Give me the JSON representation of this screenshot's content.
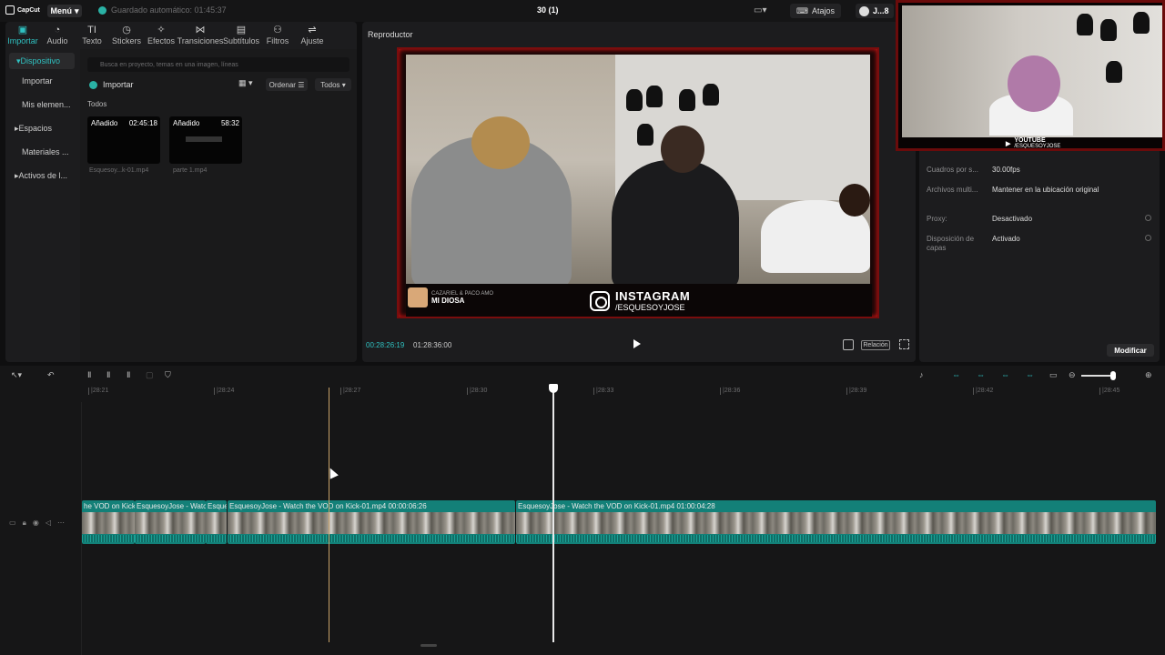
{
  "app": {
    "logo_text": "CapCut",
    "menu_label": "Menú",
    "autosave_text": "Guardado automático: 01:45:37",
    "project_title": "30 (1)",
    "shortcuts_label": "Atajos",
    "user_label": "J...8"
  },
  "tabs": [
    {
      "label": "Importar",
      "icon": "import-icon"
    },
    {
      "label": "Audio",
      "icon": "audio-icon"
    },
    {
      "label": "Texto",
      "icon": "text-icon"
    },
    {
      "label": "Stickers",
      "icon": "sticker-icon"
    },
    {
      "label": "Efectos",
      "icon": "effects-icon"
    },
    {
      "label": "Transiciones",
      "icon": "transitions-icon"
    },
    {
      "label": "Subtítulos",
      "icon": "subtitles-icon"
    },
    {
      "label": "Filtros",
      "icon": "filters-icon"
    },
    {
      "label": "Ajuste",
      "icon": "adjust-icon"
    }
  ],
  "sidebar": {
    "items": [
      "Dispositivo",
      "Importar",
      "Mis elemen...",
      "Espacios",
      "Materiales ...",
      "Activos de l..."
    ]
  },
  "media": {
    "search_placeholder": "Busca en proyecto, temas en una imagen, líneas",
    "import_label": "Importar",
    "order_label": "Ordenar",
    "all_filter_label": "Todos",
    "section_label": "Todos",
    "clips": [
      {
        "badge": "Añadido",
        "duration": "02:45:18",
        "name": "Esquesoy...k-01.mp4"
      },
      {
        "badge": "Añadido",
        "duration": "58:32",
        "name": "parte 1.mp4"
      }
    ]
  },
  "player": {
    "title": "Reproductor",
    "current_time": "00:28:26:19",
    "total_time": "01:28:36:00",
    "ratio_label": "Relación",
    "overlay": {
      "instagram_title": "INSTAGRAM",
      "instagram_handle": "/ESQUESOYJOSE",
      "now_playing_artist": "CAZARIEL & PACO AMO",
      "now_playing_title": "MI DIOSA"
    }
  },
  "webcam": {
    "youtube_label": "YOUTUBE",
    "youtube_handle": "/ESQUESOYJOSE"
  },
  "details": {
    "rows": [
      {
        "key": "Cuadros por s...",
        "value": "30.00fps"
      },
      {
        "key": "Archivos multi...",
        "value": "Mantener en la ubicación original"
      },
      {
        "key": "Proxy:",
        "value": "Desactivado"
      },
      {
        "key": "Disposición de capas",
        "value": "Activado"
      }
    ],
    "modify_label": "Modificar"
  },
  "timeline": {
    "ruler_ticks": [
      "|28:21",
      "|28:24",
      "|28:27",
      "|28:30",
      "|28:33",
      "|28:36",
      "|28:39",
      "|28:42",
      "|28:45"
    ],
    "clips": [
      {
        "label": "he VOD on Kick"
      },
      {
        "label": "EsquesoyJose - Watch"
      },
      {
        "label": "Esque"
      },
      {
        "label": "EsquesoyJose - Watch the VOD on Kick-01.mp4  00:00:06:26"
      },
      {
        "label": "EsquesoyJose - Watch the VOD on Kick-01.mp4  01:00:04:28"
      }
    ]
  }
}
